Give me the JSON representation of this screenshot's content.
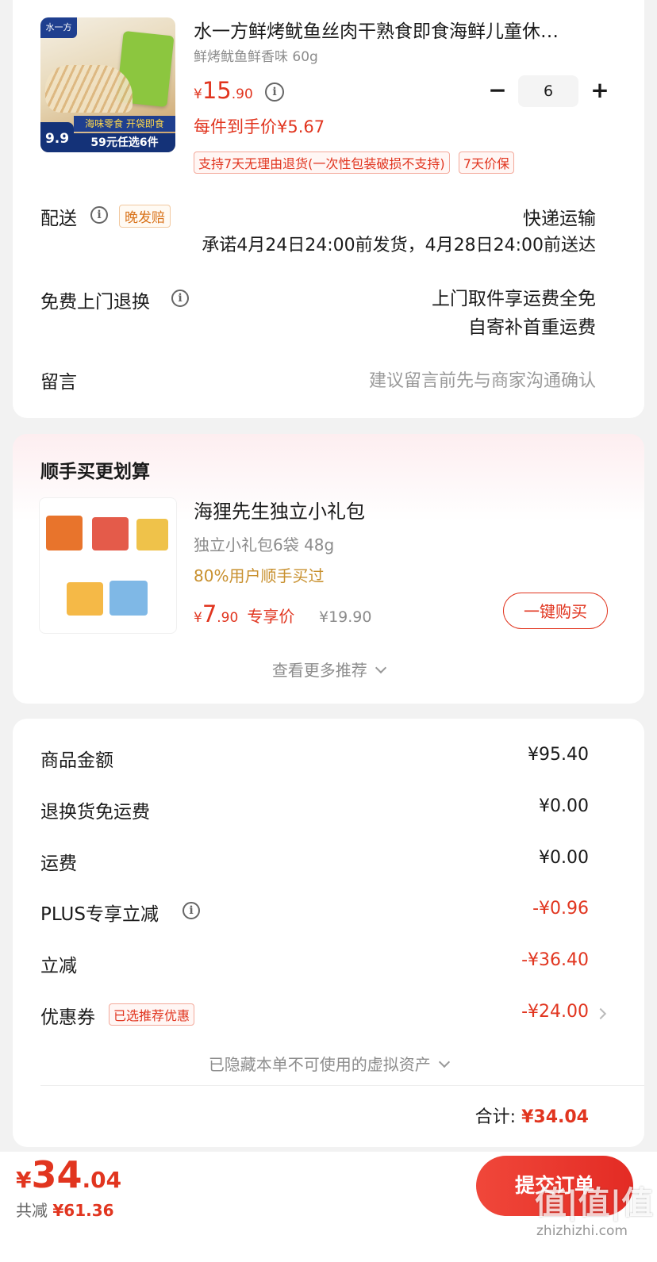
{
  "product": {
    "brand_logo_text": "水一方",
    "image_banner": "海味零食 开袋即食",
    "image_promo": "59元任选6件",
    "image_price": "9.9",
    "title": "水一方鲜烤鱿鱼丝肉干熟食即食海鲜儿童休…",
    "spec": "鲜烤鱿鱼鲜香味 60g",
    "currency": "¥",
    "price_int": "15",
    "price_dec": ".90",
    "unit_price": "每件到手价¥5.67",
    "qty": "6",
    "minus": "−",
    "plus": "+",
    "tags": [
      "支持7天无理由退货(一次性包装破损不支持)",
      "7天价保"
    ]
  },
  "delivery": {
    "label": "配送",
    "badge": "晚发赔",
    "method": "快递运输",
    "promise": "承诺4月24日24:00前发货，4月28日24:00前送达"
  },
  "returns": {
    "label": "免费上门退换",
    "line1": "上门取件享运费全免",
    "line2": "自寄补首重运费"
  },
  "message": {
    "label": "留言",
    "placeholder": "建议留言前先与商家沟通确认"
  },
  "addon": {
    "section_title": "顺手买更划算",
    "title": "海狸先生独立小礼包",
    "spec": "独立小礼包6袋 48g",
    "popularity": "80%用户顺手买过",
    "currency": "¥",
    "price_int": "7",
    "price_dec": ".90",
    "price_tag": "专享价",
    "original_price": "¥19.90",
    "buy_button": "一键购买",
    "more": "查看更多推荐",
    "more_icon": "chevron-down"
  },
  "summary": {
    "rows": [
      {
        "label": "商品金额",
        "value": "¥95.40"
      },
      {
        "label": "退换货免运费",
        "value": "¥0.00"
      },
      {
        "label": "运费",
        "value": "¥0.00"
      },
      {
        "label": "PLUS专享立减",
        "value": "-¥0.96"
      },
      {
        "label": "立减",
        "value": "-¥36.40"
      },
      {
        "label": "优惠券",
        "value": "-¥24.00",
        "badge": "已选推荐优惠"
      }
    ],
    "hidden_assets": "已隐藏本单不可使用的虚拟资产",
    "total_label": "合计:",
    "total_value": "¥34.04"
  },
  "footer": {
    "currency": "¥",
    "total_int": "34",
    "total_dec": ".04",
    "saved_label": "共减",
    "saved_value": "¥61.36",
    "submit": "提交订单"
  },
  "watermark": {
    "logo": "值|值|值",
    "url": "zhizhizhi.com"
  },
  "colors": {
    "accent_red": "#e1351f",
    "submit_button": "#e6302a",
    "gold_text": "#c8902e",
    "background": "#f2f2f2"
  }
}
